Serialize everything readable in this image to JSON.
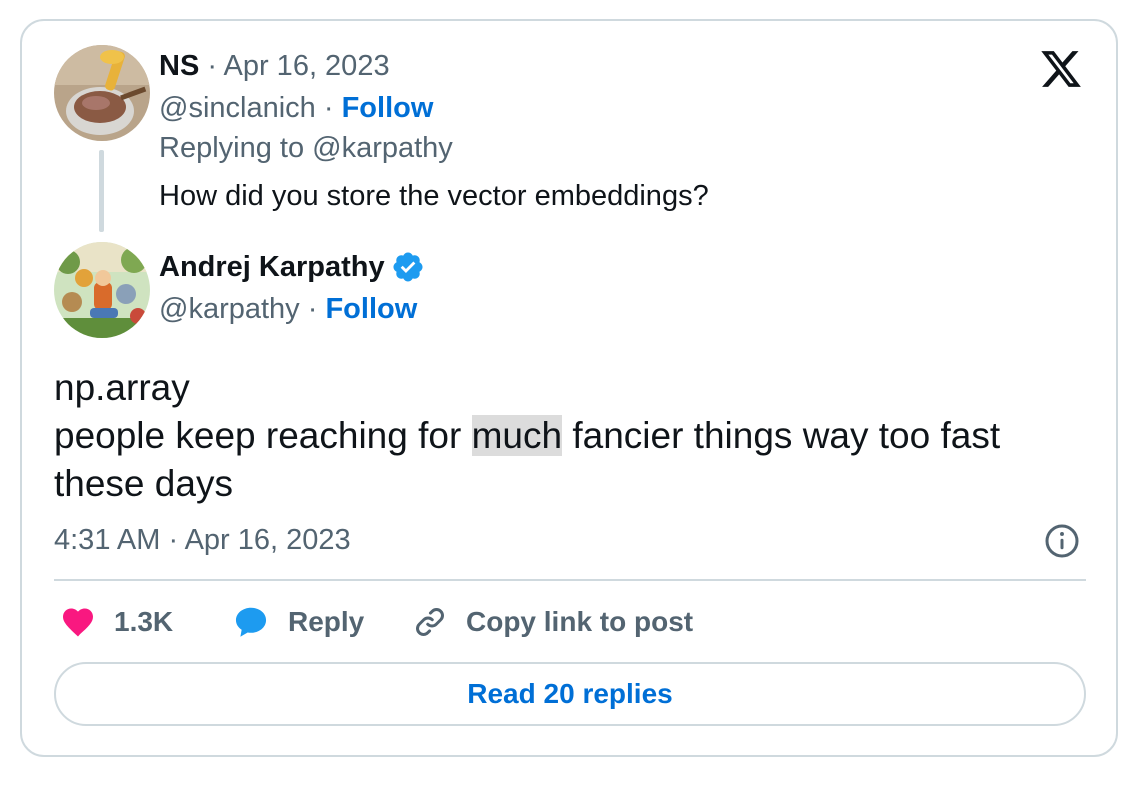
{
  "reply_tweet": {
    "author_name": "NS",
    "date": "Apr 16, 2023",
    "handle": "@sinclanich",
    "follow_label": "Follow",
    "replying_to": "Replying to @karpathy",
    "text": "How did you store the vector embeddings?"
  },
  "main_tweet": {
    "author_name": "Andrej Karpathy",
    "handle": "@karpathy",
    "follow_label": "Follow",
    "text_line1": "np.array",
    "text_line2_before": "people keep reaching for ",
    "text_line2_highlight": "much",
    "text_line2_after": " fancier things way too fast",
    "text_line3": "these days",
    "timestamp": "4:31 AM · Apr 16, 2023"
  },
  "actions": {
    "like_count": "1.3K",
    "reply_label": "Reply",
    "copy_label": "Copy link to post"
  },
  "read_replies_label": "Read 20 replies",
  "separator": "·",
  "colors": {
    "link_blue": "#006fd6",
    "like_pink": "#f91880",
    "reply_blue": "#1d9bf0",
    "verified_blue": "#1d9bf0",
    "muted_text": "#536471",
    "border": "#cfd9de"
  },
  "icons": [
    "x-logo-icon",
    "verified-badge-icon",
    "info-icon",
    "heart-icon",
    "reply-bubble-icon",
    "link-icon"
  ]
}
